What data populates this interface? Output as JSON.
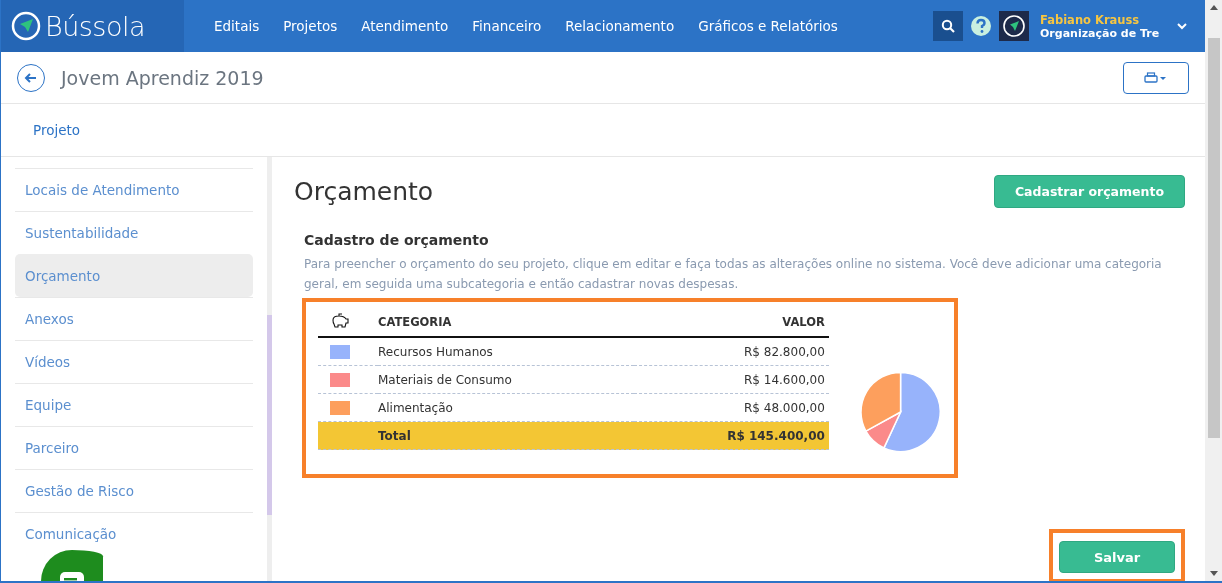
{
  "header": {
    "logo": "Bússola",
    "nav": [
      {
        "label": "Editais"
      },
      {
        "label": "Projetos"
      },
      {
        "label": "Atendimento"
      },
      {
        "label": "Financeiro"
      },
      {
        "label": "Relacionamento"
      },
      {
        "label": "Gráficos e Relatórios"
      }
    ],
    "user": {
      "name": "Fabiano Krauss",
      "org": "Organização de Tre"
    }
  },
  "page": {
    "title": "Jovem Aprendiz 2019"
  },
  "tabs": [
    {
      "label": "Projeto"
    }
  ],
  "sidebar": {
    "items": [
      {
        "label": "Locais de Atendimento",
        "selected": false
      },
      {
        "label": "Sustentabilidade",
        "selected": false
      },
      {
        "label": "Orçamento",
        "selected": true
      },
      {
        "label": "Anexos",
        "selected": false
      },
      {
        "label": "Vídeos",
        "selected": false
      },
      {
        "label": "Equipe",
        "selected": false
      },
      {
        "label": "Parceiro",
        "selected": false
      },
      {
        "label": "Gestão de Risco",
        "selected": false
      },
      {
        "label": "Comunicação",
        "selected": false
      }
    ]
  },
  "main": {
    "title": "Orçamento",
    "add_button": "Cadastrar orçamento",
    "section_title": "Cadastro de orçamento",
    "description": "Para preencher o orçamento do seu projeto, clique em editar e faça todas as alterações online no sistema. Você deve adicionar uma categoria geral, em seguida uma subcategoria e então cadastrar novas despesas.",
    "table": {
      "columns": [
        "CATEGORIA",
        "VALOR"
      ],
      "rows": [
        {
          "category": "Recursos Humanos",
          "value": "R$ 82.800,00",
          "color": "#97b3fb"
        },
        {
          "category": "Materiais de Consumo",
          "value": "R$ 14.600,00",
          "color": "#fb8a8a"
        },
        {
          "category": "Alimentação",
          "value": "R$ 48.000,00",
          "color": "#fd9f5d"
        }
      ],
      "total": {
        "label": "Total",
        "value": "R$ 145.400,00"
      }
    },
    "chart_data": {
      "type": "pie",
      "values": [
        56.9,
        10.1,
        33.0
      ]
    },
    "save_button": "Salvar"
  }
}
